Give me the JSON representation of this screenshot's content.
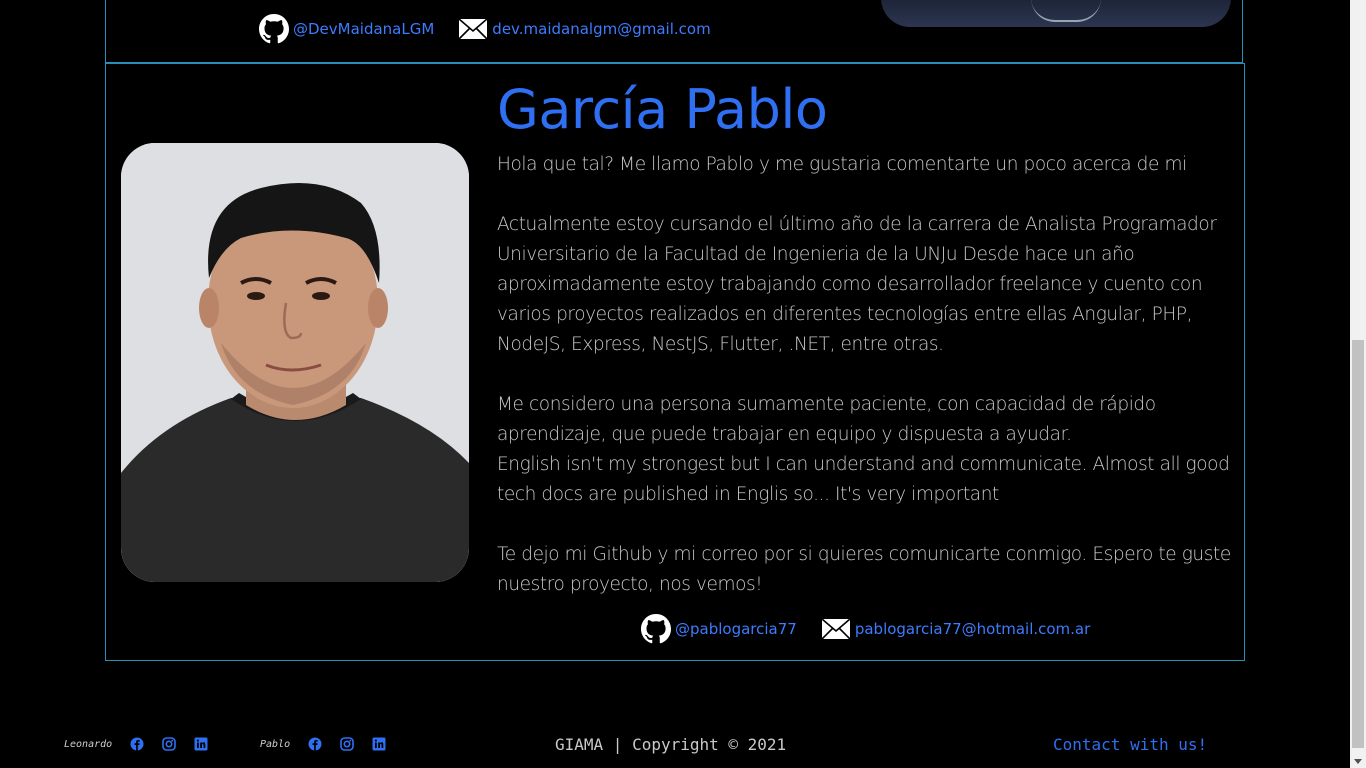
{
  "previous_card": {
    "github_handle": "@DevMaidanaLGM",
    "email": "dev.maidanalgm@gmail.com"
  },
  "profile": {
    "name": "García Pablo",
    "bio": [
      "Hola que tal? Me llamo Pablo y me gustaria comentarte un poco acerca de mi",
      "Actualmente estoy cursando el último año de la carrera de Analista Programador Universitario de la Facultad de Ingenieria de la UNJu Desde hace un año aproximadamente estoy trabajando como desarrollador freelance y cuento con varios proyectos realizados en diferentes tecnologías entre ellas Angular, PHP, NodeJS, Express, NestJS, Flutter, .NET, entre otras.",
      "Me considero una persona sumamente paciente, con capacidad de rápido aprendizaje, que puede trabajar en equipo y dispuesta a ayudar.",
      "English isn't my strongest but I can understand and communicate. Almost all good tech docs are published in Englis so... It's very important",
      "Te dejo mi Github y mi correo por si quieres comunicarte conmigo. Espero te guste nuestro proyecto, nos vemos!"
    ],
    "github_handle": "@pablogarcia77",
    "email": "pablogarcia77@hotmail.com.ar"
  },
  "footer": {
    "group1_name": "Leonardo",
    "group2_name": "Pablo",
    "copyright": "GIAMA | Copyright © 2021",
    "contact": "Contact with us!"
  },
  "colors": {
    "accent": "#2f6ff2",
    "border": "#2a8fb8",
    "background": "#000000"
  }
}
